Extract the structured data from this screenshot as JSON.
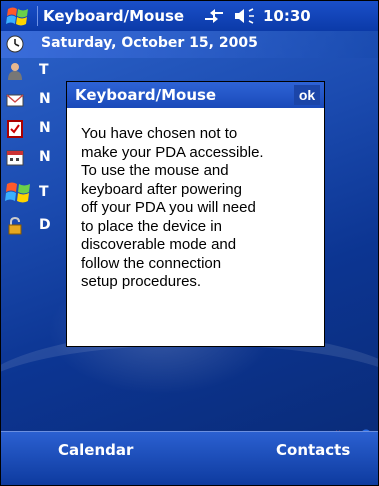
{
  "titlebar": {
    "app_title": "Keyboard/Mouse",
    "time": "10:30",
    "icons": [
      "start-flag-icon",
      "connectivity-icon",
      "volume-icon"
    ]
  },
  "today": {
    "date": "Saturday, October 15, 2005",
    "rows": [
      {
        "icon": "owner-icon",
        "text": "T"
      },
      {
        "icon": "messages-icon",
        "text": "N"
      },
      {
        "icon": "tasks-icon",
        "text": "N"
      },
      {
        "icon": "calendar-icon",
        "text": "N"
      },
      {
        "icon": "windows-flag-icon",
        "text": "T"
      },
      {
        "icon": "lock-icon",
        "text": "D"
      }
    ]
  },
  "dialog": {
    "title": "Keyboard/Mouse",
    "ok_label": "ok",
    "message_lines": [
      "You have chosen not to",
      "make your PDA accessible.",
      "To use the mouse and",
      "keyboard after powering",
      "off your PDA you will need",
      "to place the device in",
      "discoverable mode and",
      "follow the connection",
      "setup procedures."
    ]
  },
  "tray_icons": [
    "mouse-icon",
    "keyboard-icon",
    "signal-icon",
    "bluetooth-icon"
  ],
  "softkeys": {
    "left": "Calendar",
    "right": "Contacts"
  },
  "colors": {
    "accent": "#1a4ab9",
    "dialog_bg": "#ffffff"
  }
}
